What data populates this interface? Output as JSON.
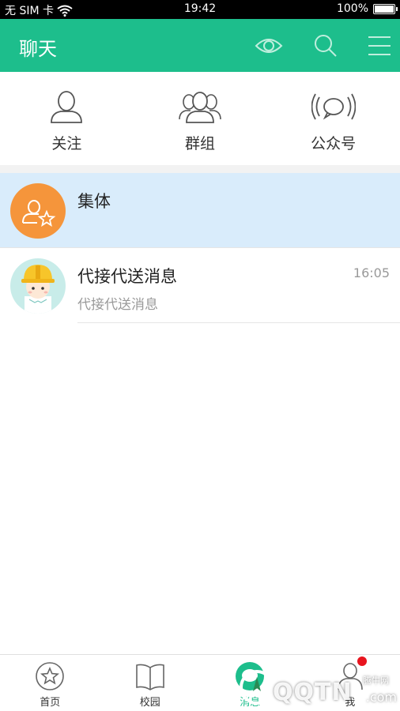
{
  "status_bar": {
    "carrier": "无 SIM 卡",
    "time": "19:42",
    "battery": "100%",
    "battery_level": 1.0
  },
  "app_bar": {
    "title": "聊天",
    "icons": [
      "eye-icon",
      "search-icon",
      "menu-icon"
    ]
  },
  "quick_actions": [
    {
      "label": "关注",
      "icon": "person-icon"
    },
    {
      "label": "群组",
      "icon": "group-icon"
    },
    {
      "label": "公众号",
      "icon": "broadcast-icon"
    }
  ],
  "chats": [
    {
      "name": "集体",
      "preview": "",
      "time": "",
      "selected": true,
      "avatar": "group-star-avatar",
      "avatar_color": "#f5953b"
    },
    {
      "name": "代接代送消息",
      "preview": "代接代送消息",
      "time": "16:05",
      "selected": false,
      "avatar": "worker-avatar"
    }
  ],
  "bottom_nav": [
    {
      "label": "首页",
      "icon": "star-icon"
    },
    {
      "label": "校园",
      "icon": "book-icon"
    },
    {
      "label": "消息",
      "icon": "chat-icon",
      "active": true
    },
    {
      "label": "我",
      "icon": "profile-icon",
      "badge": true
    }
  ],
  "watermark": {
    "text": "QQTN",
    "suffix": ".com",
    "sub": "腾牛网"
  },
  "colors": {
    "primary": "#1dbe8c",
    "selected_bg": "#d9ecfb",
    "avatar_orange": "#f5953b",
    "badge": "#e8141e"
  }
}
